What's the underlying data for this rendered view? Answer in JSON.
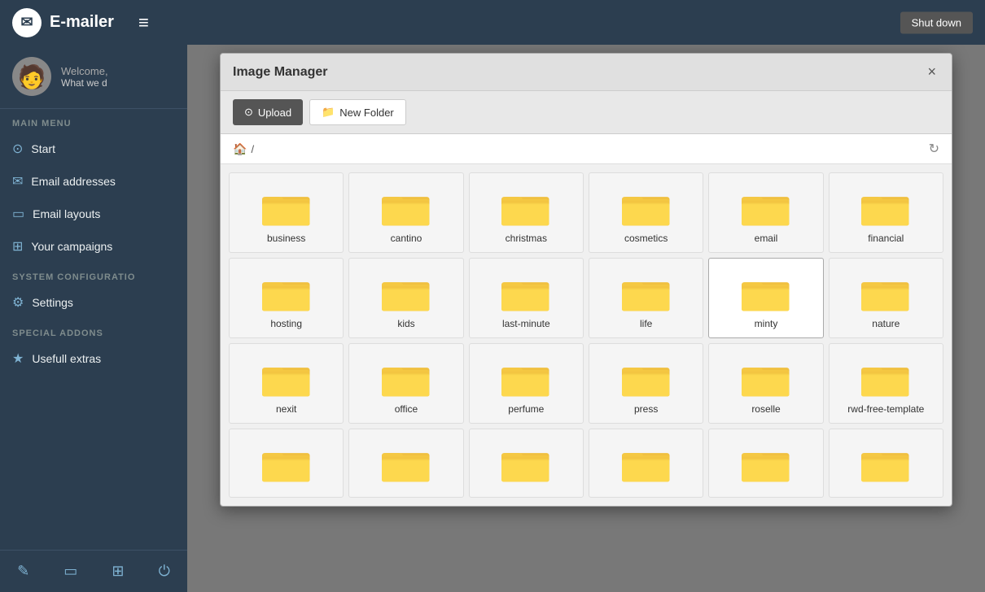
{
  "app": {
    "title": "E-mailer",
    "shutdown_label": "Shut down"
  },
  "topbar": {
    "logo_icon": "✉",
    "hamburger": "≡"
  },
  "sidebar": {
    "welcome_text": "Welcome,",
    "subtitle": "What we d",
    "main_menu_label": "MAIN MENU",
    "items": [
      {
        "label": "Start",
        "icon": "⊙"
      },
      {
        "label": "Email addresses",
        "icon": "✉"
      },
      {
        "label": "Email layouts",
        "icon": "▭"
      },
      {
        "label": "Your campaigns",
        "icon": "⊞"
      }
    ],
    "system_label": "SYSTEM CONFIGURATIO",
    "system_items": [
      {
        "label": "Settings",
        "icon": "⚙"
      }
    ],
    "addons_label": "SPECIAL ADDONS",
    "addon_items": [
      {
        "label": "Usefull extras",
        "icon": "★"
      }
    ],
    "bottom_icons": [
      "✎",
      "▭",
      "⊞",
      "⏻"
    ]
  },
  "modal": {
    "title": "Image Manager",
    "close_label": "×",
    "upload_label": "Upload",
    "new_folder_label": "New Folder",
    "breadcrumb_separator": "/",
    "folders": [
      "business",
      "cantino",
      "christmas",
      "cosmetics",
      "email",
      "financial",
      "hosting",
      "kids",
      "last-minute",
      "life",
      "minty",
      "nature",
      "nexit",
      "office",
      "perfume",
      "press",
      "roselle",
      "rwd-free-template",
      "",
      "",
      "",
      "",
      "",
      ""
    ]
  }
}
